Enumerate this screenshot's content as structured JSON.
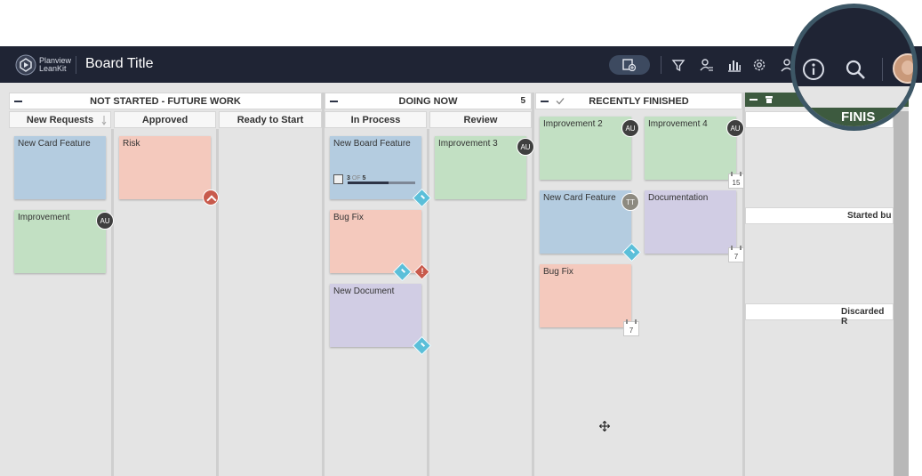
{
  "header": {
    "brand_line1": "Planview",
    "brand_line2": "LeanKit",
    "board_title": "Board Title"
  },
  "lanes": {
    "not_started": {
      "title": "NOT STARTED - FUTURE WORK",
      "sub": [
        "New Requests",
        "Approved",
        "Ready to Start"
      ]
    },
    "doing_now": {
      "title": "DOING NOW",
      "count": "5",
      "sub": [
        "In Process",
        "Review"
      ]
    },
    "recently_finished": {
      "title": "RECENTLY FINISHED"
    },
    "finished": {
      "title": "FINISHED",
      "title_partial": "FINIS",
      "panels": [
        "Started bu",
        "Discarded R"
      ]
    }
  },
  "cards": [
    {
      "title": "New Card Feature",
      "color": "#b4cce0"
    },
    {
      "title": "Improvement",
      "color": "#c2e0c3",
      "avatar": "AU"
    },
    {
      "title": "Risk",
      "color": "#f4c9bd"
    },
    {
      "title": "New Board Feature",
      "color": "#b4cce0",
      "progress": {
        "done": "3",
        "of": "OF",
        "total": "5",
        "fraction": 0.6
      }
    },
    {
      "title": "Bug Fix",
      "color": "#f4c9bd"
    },
    {
      "title": "New Document",
      "color": "#d1cde4"
    },
    {
      "title": "Improvement 3",
      "color": "#c2e0c3",
      "avatar": "AU"
    },
    {
      "title": "Improvement 2",
      "color": "#c2e0c3",
      "avatar": "AU"
    },
    {
      "title": "Improvement 4",
      "color": "#c2e0c3",
      "avatar": "AU",
      "date_badge": "15"
    },
    {
      "title": "New Card Feature",
      "color": "#b4cce0",
      "avatar": "TT"
    },
    {
      "title": "Documentation",
      "color": "#d1cde4",
      "date_badge": "7"
    },
    {
      "title": "Bug Fix",
      "color": "#f4c9bd",
      "date_badge": "7"
    }
  ],
  "icons": [
    "board-add-icon",
    "filter-icon",
    "user-filter-icon",
    "analytics-icon",
    "settings-icon",
    "info-icon",
    "search-icon",
    "move-cursor-icon"
  ],
  "colors": {
    "topbar": "#1f2434",
    "finished_lane": "#3d5a3f",
    "magnifier_ring": "#3d5766",
    "tag": "#5bbfd9",
    "risk": "#c85a4c"
  }
}
